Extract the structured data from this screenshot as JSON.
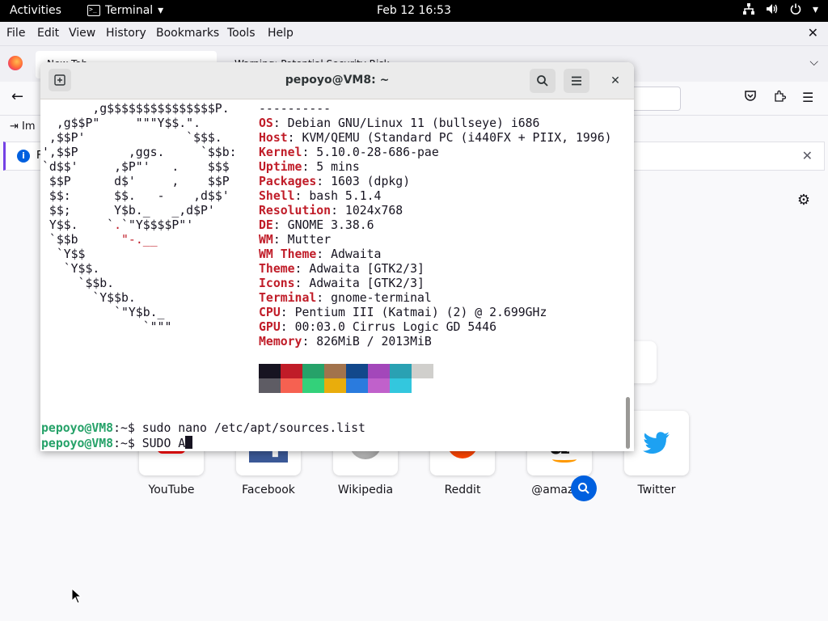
{
  "topbar": {
    "activities": "Activities",
    "app_name": "Terminal",
    "clock": "Feb 12  16:53"
  },
  "firefox": {
    "menu": [
      "File",
      "Edit",
      "View",
      "History",
      "Bookmarks",
      "Tools",
      "Help"
    ],
    "tab1": "New Tab",
    "tab2": "Warning: Potential Security Risk",
    "bookmark_import": "Im",
    "infobar_text": "F",
    "top_sites": [
      {
        "label": "YouTube",
        "icon": "youtube-icon"
      },
      {
        "label": "Facebook",
        "icon": "facebook-icon"
      },
      {
        "label": "Wikipedia",
        "icon": "wikipedia-icon"
      },
      {
        "label": "Reddit",
        "icon": "reddit-icon"
      },
      {
        "label": "@amazon",
        "icon": "amazon-icon"
      },
      {
        "label": "Twitter",
        "icon": "twitter-icon"
      }
    ]
  },
  "terminal": {
    "title": "pepoyo@VM8: ~",
    "ascii_art": [
      "       ,g$$$$$$$$$$$$$$$P.",
      "  ,g$$P\"     \"\"\"Y$$.\".",
      " ,$$P'              `$$$.",
      "',$$P       ,ggs.     `$$b:",
      "`d$$'     ,$P\"'   .    $$$",
      " $$P      d$'     ,    $$P",
      " $$:      $$.   -    ,d$$'",
      " $$;      Y$b._   _,d$P'",
      " Y$$.    `.`\"Y$$$$P\"'",
      " `$$b      \"-.__",
      "  `Y$$",
      "   `Y$$.",
      "     `$$b.",
      "       `Y$$b.",
      "          `\"Y$b._",
      "              `\"\"\""
    ],
    "separator": "----------",
    "info": [
      {
        "key": "OS",
        "value": "Debian GNU/Linux 11 (bullseye) i686"
      },
      {
        "key": "Host",
        "value": "KVM/QEMU (Standard PC (i440FX + PIIX, 1996)"
      },
      {
        "key": "Kernel",
        "value": "5.10.0-28-686-pae"
      },
      {
        "key": "Uptime",
        "value": "5 mins"
      },
      {
        "key": "Packages",
        "value": "1603 (dpkg)"
      },
      {
        "key": "Shell",
        "value": "bash 5.1.4"
      },
      {
        "key": "Resolution",
        "value": "1024x768"
      },
      {
        "key": "DE",
        "value": "GNOME 3.38.6"
      },
      {
        "key": "WM",
        "value": "Mutter"
      },
      {
        "key": "WM Theme",
        "value": "Adwaita"
      },
      {
        "key": "Theme",
        "value": "Adwaita [GTK2/3]"
      },
      {
        "key": "Icons",
        "value": "Adwaita [GTK2/3]"
      },
      {
        "key": "Terminal",
        "value": "gnome-terminal"
      },
      {
        "key": "CPU",
        "value": "Pentium III (Katmai) (2) @ 2.699GHz"
      },
      {
        "key": "GPU",
        "value": "00:03.0 Cirrus Logic GD 5446"
      },
      {
        "key": "Memory",
        "value": "826MiB / 2013MiB"
      }
    ],
    "palette_row1": [
      "#171421",
      "#c01c28",
      "#26a269",
      "#a2734c",
      "#12488b",
      "#a347ba",
      "#2aa1b3",
      "#d0cfcc"
    ],
    "palette_row2": [
      "#5e5c64",
      "#f66151",
      "#33d17a",
      "#e9ad0c",
      "#2a7bde",
      "#c061cb",
      "#33c7de"
    ],
    "prompt_user": "pepoyo@VM8",
    "prompt_suffix": ":~$ ",
    "cmd1": "sudo nano /etc/apt/sources.list",
    "cmd2": "SUDO A"
  },
  "colors": {
    "ascii_red": "#c01c28",
    "prompt_green": "#26a269",
    "accent_blue": "#0060df"
  }
}
